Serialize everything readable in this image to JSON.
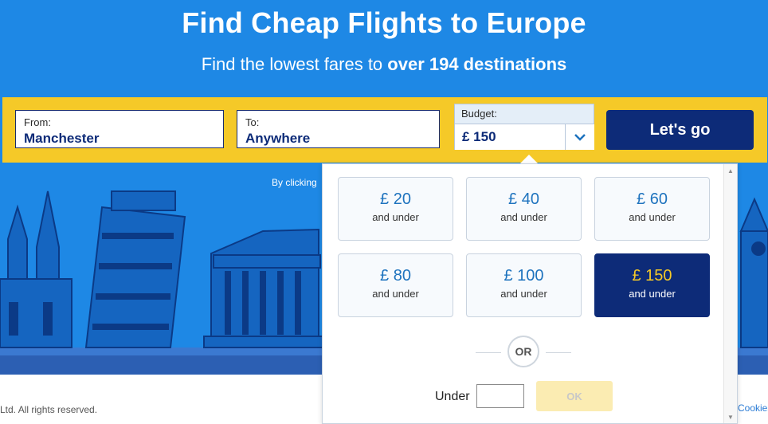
{
  "hero": {
    "title": "Find Cheap Flights to Europe",
    "subtitle_prefix": "Find the lowest fares to ",
    "subtitle_emphasis": "over 194 destinations"
  },
  "search": {
    "from_label": "From:",
    "from_value": "Manchester",
    "to_label": "To:",
    "to_value": "Anywhere",
    "budget_label": "Budget:",
    "budget_value": "£ 150",
    "go_label": "Let's go"
  },
  "terms_text": "By clicking",
  "budget_dropdown": {
    "options": [
      {
        "amount": "£ 20",
        "sub": "and under"
      },
      {
        "amount": "£ 40",
        "sub": "and under"
      },
      {
        "amount": "£ 60",
        "sub": "and under"
      },
      {
        "amount": "£ 80",
        "sub": "and under"
      },
      {
        "amount": "£ 100",
        "sub": "and under"
      },
      {
        "amount": "£ 150",
        "sub": "and under"
      }
    ],
    "selected_amount": "£ 150",
    "or_label": "OR",
    "custom_label": "Under",
    "custom_value": "",
    "ok_label": "OK"
  },
  "footer": {
    "copyright": "Ltd. All rights reserved.",
    "cookies_link": "Cookies"
  },
  "colors": {
    "hero_bg": "#1e88e5",
    "search_bar_bg": "#f5c928",
    "brand_navy": "#0d2b78",
    "selected_amount": "#f5c928"
  }
}
